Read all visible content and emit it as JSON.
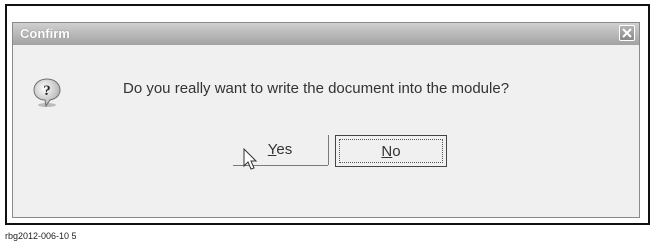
{
  "dialog": {
    "title": "Confirm",
    "close_icon": "close-icon",
    "question_icon": "question-icon",
    "message": "Do you really want to write the document into the module?",
    "yes_button": {
      "mnemonic": "Y",
      "rest": "es"
    },
    "no_button": {
      "mnemonic": "N",
      "rest": "o"
    }
  },
  "caption": "rbg2012-006-10 5"
}
